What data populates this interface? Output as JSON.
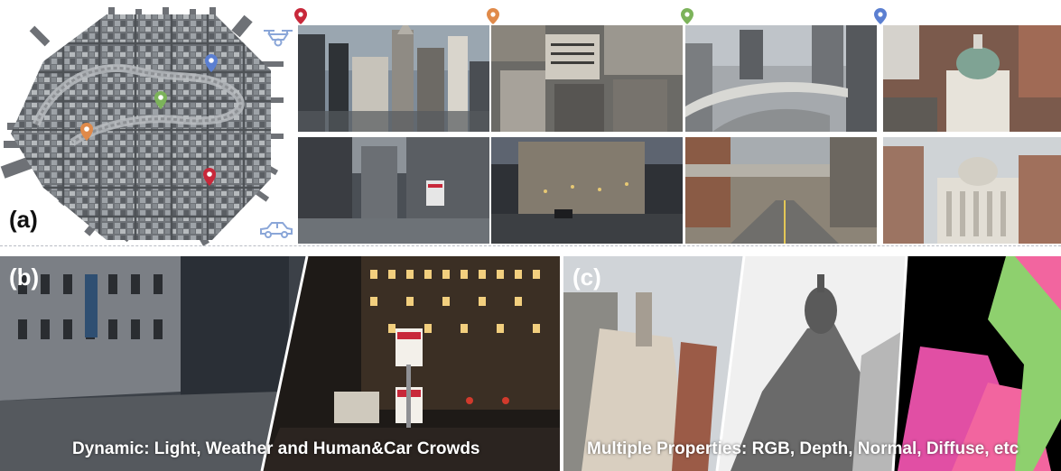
{
  "panels": {
    "a": {
      "label": "(a)"
    },
    "b": {
      "label": "(b)",
      "caption": "Dynamic: Light, Weather and Human&Car Crowds"
    },
    "c": {
      "label": "(c)",
      "caption": "Multiple Properties: RGB, Depth, Normal, Diffuse, etc"
    }
  },
  "colors": {
    "pin_red": "#c8283a",
    "pin_orange": "#e08a4a",
    "pin_green": "#7cb35a",
    "pin_blue": "#5b7fd1",
    "icon_blue": "#8aa6d8"
  },
  "icons": [
    "drone-icon",
    "car-icon",
    "location-pin-icon"
  ]
}
